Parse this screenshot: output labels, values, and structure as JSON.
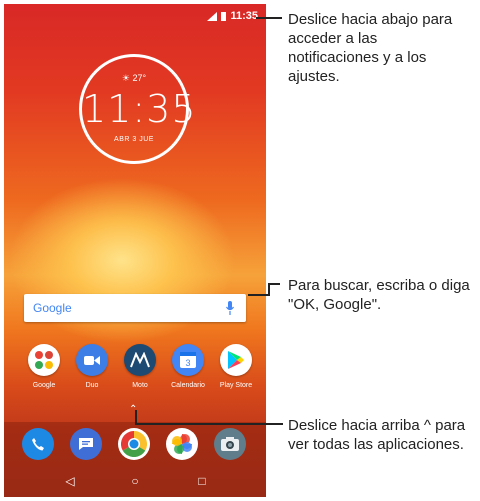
{
  "status": {
    "time": "11:35"
  },
  "clock": {
    "weather": "☀ 27°",
    "time": "11:35",
    "date": "ABR 3 JUE"
  },
  "search": {
    "logo": "Google"
  },
  "apps": [
    {
      "label": "Google",
      "icon": "google-folder-icon",
      "color": "#ffffff"
    },
    {
      "label": "Duo",
      "icon": "duo-icon",
      "color": "#3d7ee6"
    },
    {
      "label": "Moto",
      "icon": "moto-icon",
      "color": "#1c4a73"
    },
    {
      "label": "Calendario",
      "icon": "calendar-icon",
      "color": "#4285f4"
    },
    {
      "label": "Play Store",
      "icon": "play-store-icon",
      "color": "#ffffff"
    }
  ],
  "dock": [
    {
      "icon": "phone-icon",
      "color": "#1e88e5"
    },
    {
      "icon": "messages-icon",
      "color": "#3f6fd6"
    },
    {
      "icon": "chrome-icon",
      "color": "#ffffff"
    },
    {
      "icon": "photos-icon",
      "color": "#ffffff"
    },
    {
      "icon": "camera-icon",
      "color": "#607d8b"
    }
  ],
  "nav": {
    "back": "◁",
    "home": "○",
    "recents": "□"
  },
  "annotations": {
    "top": "Deslice hacia abajo para acceder a las notificaciones y a los ajustes.",
    "middle": "Para buscar, escriba o diga \"OK, Google\".",
    "bottom": "Deslice hacia arriba ^ para ver todas las aplicaciones."
  },
  "colors": {
    "accent_blue": "#4285f4",
    "text": "#222222"
  }
}
